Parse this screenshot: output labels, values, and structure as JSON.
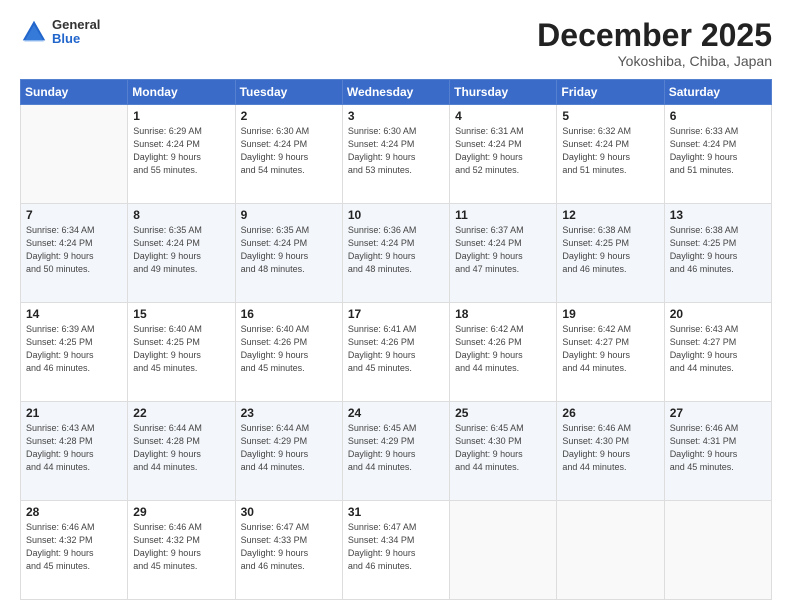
{
  "header": {
    "logo": {
      "general": "General",
      "blue": "Blue"
    },
    "title": "December 2025",
    "location": "Yokoshiba, Chiba, Japan"
  },
  "days_header": [
    "Sunday",
    "Monday",
    "Tuesday",
    "Wednesday",
    "Thursday",
    "Friday",
    "Saturday"
  ],
  "weeks": [
    [
      {
        "day": "",
        "info": ""
      },
      {
        "day": "1",
        "info": "Sunrise: 6:29 AM\nSunset: 4:24 PM\nDaylight: 9 hours\nand 55 minutes."
      },
      {
        "day": "2",
        "info": "Sunrise: 6:30 AM\nSunset: 4:24 PM\nDaylight: 9 hours\nand 54 minutes."
      },
      {
        "day": "3",
        "info": "Sunrise: 6:30 AM\nSunset: 4:24 PM\nDaylight: 9 hours\nand 53 minutes."
      },
      {
        "day": "4",
        "info": "Sunrise: 6:31 AM\nSunset: 4:24 PM\nDaylight: 9 hours\nand 52 minutes."
      },
      {
        "day": "5",
        "info": "Sunrise: 6:32 AM\nSunset: 4:24 PM\nDaylight: 9 hours\nand 51 minutes."
      },
      {
        "day": "6",
        "info": "Sunrise: 6:33 AM\nSunset: 4:24 PM\nDaylight: 9 hours\nand 51 minutes."
      }
    ],
    [
      {
        "day": "7",
        "info": "Sunrise: 6:34 AM\nSunset: 4:24 PM\nDaylight: 9 hours\nand 50 minutes."
      },
      {
        "day": "8",
        "info": "Sunrise: 6:35 AM\nSunset: 4:24 PM\nDaylight: 9 hours\nand 49 minutes."
      },
      {
        "day": "9",
        "info": "Sunrise: 6:35 AM\nSunset: 4:24 PM\nDaylight: 9 hours\nand 48 minutes."
      },
      {
        "day": "10",
        "info": "Sunrise: 6:36 AM\nSunset: 4:24 PM\nDaylight: 9 hours\nand 48 minutes."
      },
      {
        "day": "11",
        "info": "Sunrise: 6:37 AM\nSunset: 4:24 PM\nDaylight: 9 hours\nand 47 minutes."
      },
      {
        "day": "12",
        "info": "Sunrise: 6:38 AM\nSunset: 4:25 PM\nDaylight: 9 hours\nand 46 minutes."
      },
      {
        "day": "13",
        "info": "Sunrise: 6:38 AM\nSunset: 4:25 PM\nDaylight: 9 hours\nand 46 minutes."
      }
    ],
    [
      {
        "day": "14",
        "info": "Sunrise: 6:39 AM\nSunset: 4:25 PM\nDaylight: 9 hours\nand 46 minutes."
      },
      {
        "day": "15",
        "info": "Sunrise: 6:40 AM\nSunset: 4:25 PM\nDaylight: 9 hours\nand 45 minutes."
      },
      {
        "day": "16",
        "info": "Sunrise: 6:40 AM\nSunset: 4:26 PM\nDaylight: 9 hours\nand 45 minutes."
      },
      {
        "day": "17",
        "info": "Sunrise: 6:41 AM\nSunset: 4:26 PM\nDaylight: 9 hours\nand 45 minutes."
      },
      {
        "day": "18",
        "info": "Sunrise: 6:42 AM\nSunset: 4:26 PM\nDaylight: 9 hours\nand 44 minutes."
      },
      {
        "day": "19",
        "info": "Sunrise: 6:42 AM\nSunset: 4:27 PM\nDaylight: 9 hours\nand 44 minutes."
      },
      {
        "day": "20",
        "info": "Sunrise: 6:43 AM\nSunset: 4:27 PM\nDaylight: 9 hours\nand 44 minutes."
      }
    ],
    [
      {
        "day": "21",
        "info": "Sunrise: 6:43 AM\nSunset: 4:28 PM\nDaylight: 9 hours\nand 44 minutes."
      },
      {
        "day": "22",
        "info": "Sunrise: 6:44 AM\nSunset: 4:28 PM\nDaylight: 9 hours\nand 44 minutes."
      },
      {
        "day": "23",
        "info": "Sunrise: 6:44 AM\nSunset: 4:29 PM\nDaylight: 9 hours\nand 44 minutes."
      },
      {
        "day": "24",
        "info": "Sunrise: 6:45 AM\nSunset: 4:29 PM\nDaylight: 9 hours\nand 44 minutes."
      },
      {
        "day": "25",
        "info": "Sunrise: 6:45 AM\nSunset: 4:30 PM\nDaylight: 9 hours\nand 44 minutes."
      },
      {
        "day": "26",
        "info": "Sunrise: 6:46 AM\nSunset: 4:30 PM\nDaylight: 9 hours\nand 44 minutes."
      },
      {
        "day": "27",
        "info": "Sunrise: 6:46 AM\nSunset: 4:31 PM\nDaylight: 9 hours\nand 45 minutes."
      }
    ],
    [
      {
        "day": "28",
        "info": "Sunrise: 6:46 AM\nSunset: 4:32 PM\nDaylight: 9 hours\nand 45 minutes."
      },
      {
        "day": "29",
        "info": "Sunrise: 6:46 AM\nSunset: 4:32 PM\nDaylight: 9 hours\nand 45 minutes."
      },
      {
        "day": "30",
        "info": "Sunrise: 6:47 AM\nSunset: 4:33 PM\nDaylight: 9 hours\nand 46 minutes."
      },
      {
        "day": "31",
        "info": "Sunrise: 6:47 AM\nSunset: 4:34 PM\nDaylight: 9 hours\nand 46 minutes."
      },
      {
        "day": "",
        "info": ""
      },
      {
        "day": "",
        "info": ""
      },
      {
        "day": "",
        "info": ""
      }
    ]
  ]
}
